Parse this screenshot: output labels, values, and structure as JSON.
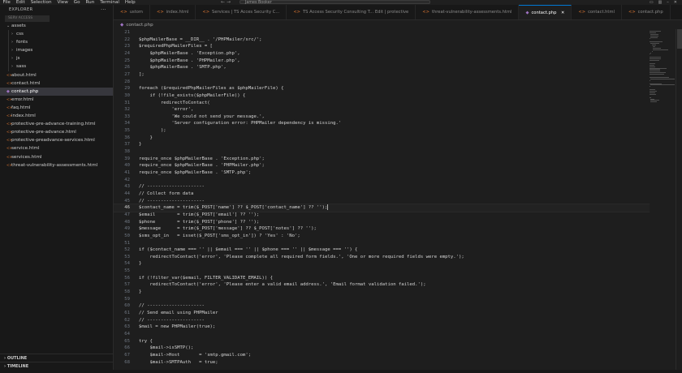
{
  "menu": [
    "File",
    "Edit",
    "Selection",
    "View",
    "Go",
    "Run",
    "Terminal",
    "Help"
  ],
  "command_center": "James Booker",
  "sidebar": {
    "title": "EXPLORER",
    "more": "···",
    "workspace": "SERV ACCESS",
    "tree": [
      {
        "label": "assets",
        "type": "folder-open",
        "indent": 1
      },
      {
        "label": "css",
        "type": "folder",
        "indent": 2
      },
      {
        "label": "fonts",
        "type": "folder",
        "indent": 2
      },
      {
        "label": "images",
        "type": "folder",
        "indent": 2
      },
      {
        "label": "js",
        "type": "folder",
        "indent": 2
      },
      {
        "label": "sass",
        "type": "folder",
        "indent": 2
      },
      {
        "label": "about.html",
        "type": "html",
        "indent": 1
      },
      {
        "label": "contact.html",
        "type": "html",
        "indent": 1
      },
      {
        "label": "contact.php",
        "type": "php",
        "indent": 1,
        "active": true
      },
      {
        "label": "error.html",
        "type": "html",
        "indent": 1
      },
      {
        "label": "faq.html",
        "type": "html",
        "indent": 1
      },
      {
        "label": "index.html",
        "type": "html",
        "indent": 1
      },
      {
        "label": "protective-pre-advance-training.html",
        "type": "html",
        "indent": 1
      },
      {
        "label": "protective-pre-advance.html",
        "type": "html",
        "indent": 1
      },
      {
        "label": "protective-preadvance-services.html",
        "type": "html",
        "indent": 1
      },
      {
        "label": "service.html",
        "type": "html",
        "indent": 1
      },
      {
        "label": "services.html",
        "type": "html",
        "indent": 1
      },
      {
        "label": "threat-vulnerability-assessments.html",
        "type": "html",
        "indent": 1
      }
    ],
    "outline": "OUTLINE",
    "timeline": "TIMELINE"
  },
  "tabs": [
    {
      "label": "ustom"
    },
    {
      "label": "index.html"
    },
    {
      "label": "Services | TS Acces Security C..."
    },
    {
      "label": "TS Access Security Consulting T... Edit | protective"
    },
    {
      "label": "threat-vulnerability-assessments.html"
    },
    {
      "label": "contact.php",
      "active": true
    },
    {
      "label": "contact.html"
    },
    {
      "label": "contact.php"
    }
  ],
  "breadcrumb": "contact.php",
  "editor": {
    "current_line": 46,
    "lines": [
      {
        "n": "21",
        "t": ""
      },
      {
        "n": "22",
        "t": "$phpMailerBase = __DIR__ . '/PHPMailer/src/';"
      },
      {
        "n": "23",
        "t": "$requiredPhpMailerFiles = ["
      },
      {
        "n": "24",
        "t": "    $phpMailerBase . 'Exception.php',"
      },
      {
        "n": "25",
        "t": "    $phpMailerBase . 'PHPMailer.php',"
      },
      {
        "n": "26",
        "t": "    $phpMailerBase . 'SMTP.php',"
      },
      {
        "n": "27",
        "t": "];"
      },
      {
        "n": "28",
        "t": ""
      },
      {
        "n": "29",
        "t": "foreach ($requiredPhpMailerFiles as $phpMailerFile) {"
      },
      {
        "n": "30",
        "t": "    if (!file_exists($phpMailerFile)) {"
      },
      {
        "n": "31",
        "t": "        redirectToContact("
      },
      {
        "n": "32",
        "t": "            'error',"
      },
      {
        "n": "33",
        "t": "            'We could not send your message.',"
      },
      {
        "n": "34",
        "t": "            'Server configuration error: PHPMailer dependency is missing.'"
      },
      {
        "n": "35",
        "t": "        );"
      },
      {
        "n": "36",
        "t": "    }"
      },
      {
        "n": "37",
        "t": "}"
      },
      {
        "n": "38",
        "t": ""
      },
      {
        "n": "39",
        "t": "require_once $phpMailerBase . 'Exception.php';"
      },
      {
        "n": "40",
        "t": "require_once $phpMailerBase . 'PHPMailer.php';"
      },
      {
        "n": "41",
        "t": "require_once $phpMailerBase . 'SMTP.php';"
      },
      {
        "n": "42",
        "t": ""
      },
      {
        "n": "43",
        "t": "// ---------------------"
      },
      {
        "n": "44",
        "t": "// Collect form data"
      },
      {
        "n": "45",
        "t": "// ---------------------"
      },
      {
        "n": "46",
        "t": "$contact_name = trim($_POST['name'] ?? $_POST['contact_name'] ?? '');"
      },
      {
        "n": "47",
        "t": "$email        = trim($_POST['email'] ?? '');"
      },
      {
        "n": "48",
        "t": "$phone        = trim($_POST['phone'] ?? '');"
      },
      {
        "n": "49",
        "t": "$message      = trim($_POST['message'] ?? $_POST['notes'] ?? '');"
      },
      {
        "n": "50",
        "t": "$sms_opt_in   = isset($_POST['sms_opt_in']) ? 'Yes' : 'No';"
      },
      {
        "n": "51",
        "t": ""
      },
      {
        "n": "52",
        "t": "if ($contact_name === '' || $email === '' || $phone === '' || $message === '') {"
      },
      {
        "n": "53",
        "t": "    redirectToContact('error', 'Please complete all required form fields.', 'One or more required fields were empty.');"
      },
      {
        "n": "54",
        "t": "}"
      },
      {
        "n": "55",
        "t": ""
      },
      {
        "n": "56",
        "t": "if (!filter_var($email, FILTER_VALIDATE_EMAIL)) {"
      },
      {
        "n": "57",
        "t": "    redirectToContact('error', 'Please enter a valid email address.', 'Email format validation failed.');"
      },
      {
        "n": "58",
        "t": "}"
      },
      {
        "n": "59",
        "t": ""
      },
      {
        "n": "60",
        "t": "// ---------------------"
      },
      {
        "n": "61",
        "t": "// Send email using PHPMailer"
      },
      {
        "n": "62",
        "t": "// ---------------------"
      },
      {
        "n": "63",
        "t": "$mail = new PHPMailer(true);"
      },
      {
        "n": "64",
        "t": ""
      },
      {
        "n": "65",
        "t": "try {"
      },
      {
        "n": "66",
        "t": "    $mail->isSMTP();"
      },
      {
        "n": "67",
        "t": "    $mail->Host       = 'smtp.gmail.com';"
      },
      {
        "n": "68",
        "t": "    $mail->SMTPAuth   = true;"
      }
    ]
  }
}
